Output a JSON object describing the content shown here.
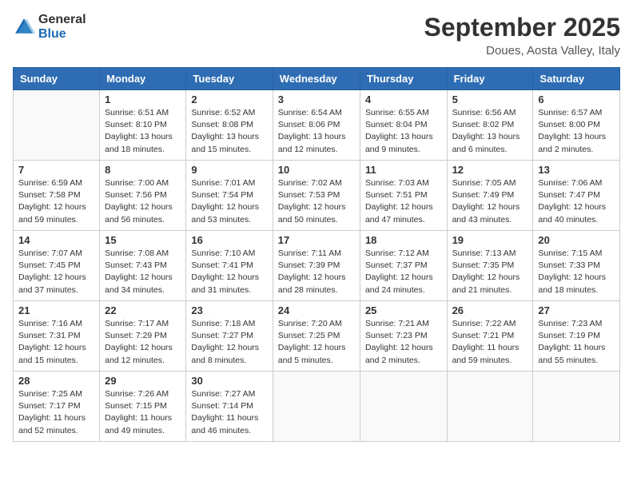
{
  "header": {
    "logo_general": "General",
    "logo_blue": "Blue",
    "month_title": "September 2025",
    "location": "Doues, Aosta Valley, Italy"
  },
  "weekdays": [
    "Sunday",
    "Monday",
    "Tuesday",
    "Wednesday",
    "Thursday",
    "Friday",
    "Saturday"
  ],
  "weeks": [
    [
      {
        "day": "",
        "info": ""
      },
      {
        "day": "1",
        "info": "Sunrise: 6:51 AM\nSunset: 8:10 PM\nDaylight: 13 hours\nand 18 minutes."
      },
      {
        "day": "2",
        "info": "Sunrise: 6:52 AM\nSunset: 8:08 PM\nDaylight: 13 hours\nand 15 minutes."
      },
      {
        "day": "3",
        "info": "Sunrise: 6:54 AM\nSunset: 8:06 PM\nDaylight: 13 hours\nand 12 minutes."
      },
      {
        "day": "4",
        "info": "Sunrise: 6:55 AM\nSunset: 8:04 PM\nDaylight: 13 hours\nand 9 minutes."
      },
      {
        "day": "5",
        "info": "Sunrise: 6:56 AM\nSunset: 8:02 PM\nDaylight: 13 hours\nand 6 minutes."
      },
      {
        "day": "6",
        "info": "Sunrise: 6:57 AM\nSunset: 8:00 PM\nDaylight: 13 hours\nand 2 minutes."
      }
    ],
    [
      {
        "day": "7",
        "info": "Sunrise: 6:59 AM\nSunset: 7:58 PM\nDaylight: 12 hours\nand 59 minutes."
      },
      {
        "day": "8",
        "info": "Sunrise: 7:00 AM\nSunset: 7:56 PM\nDaylight: 12 hours\nand 56 minutes."
      },
      {
        "day": "9",
        "info": "Sunrise: 7:01 AM\nSunset: 7:54 PM\nDaylight: 12 hours\nand 53 minutes."
      },
      {
        "day": "10",
        "info": "Sunrise: 7:02 AM\nSunset: 7:53 PM\nDaylight: 12 hours\nand 50 minutes."
      },
      {
        "day": "11",
        "info": "Sunrise: 7:03 AM\nSunset: 7:51 PM\nDaylight: 12 hours\nand 47 minutes."
      },
      {
        "day": "12",
        "info": "Sunrise: 7:05 AM\nSunset: 7:49 PM\nDaylight: 12 hours\nand 43 minutes."
      },
      {
        "day": "13",
        "info": "Sunrise: 7:06 AM\nSunset: 7:47 PM\nDaylight: 12 hours\nand 40 minutes."
      }
    ],
    [
      {
        "day": "14",
        "info": "Sunrise: 7:07 AM\nSunset: 7:45 PM\nDaylight: 12 hours\nand 37 minutes."
      },
      {
        "day": "15",
        "info": "Sunrise: 7:08 AM\nSunset: 7:43 PM\nDaylight: 12 hours\nand 34 minutes."
      },
      {
        "day": "16",
        "info": "Sunrise: 7:10 AM\nSunset: 7:41 PM\nDaylight: 12 hours\nand 31 minutes."
      },
      {
        "day": "17",
        "info": "Sunrise: 7:11 AM\nSunset: 7:39 PM\nDaylight: 12 hours\nand 28 minutes."
      },
      {
        "day": "18",
        "info": "Sunrise: 7:12 AM\nSunset: 7:37 PM\nDaylight: 12 hours\nand 24 minutes."
      },
      {
        "day": "19",
        "info": "Sunrise: 7:13 AM\nSunset: 7:35 PM\nDaylight: 12 hours\nand 21 minutes."
      },
      {
        "day": "20",
        "info": "Sunrise: 7:15 AM\nSunset: 7:33 PM\nDaylight: 12 hours\nand 18 minutes."
      }
    ],
    [
      {
        "day": "21",
        "info": "Sunrise: 7:16 AM\nSunset: 7:31 PM\nDaylight: 12 hours\nand 15 minutes."
      },
      {
        "day": "22",
        "info": "Sunrise: 7:17 AM\nSunset: 7:29 PM\nDaylight: 12 hours\nand 12 minutes."
      },
      {
        "day": "23",
        "info": "Sunrise: 7:18 AM\nSunset: 7:27 PM\nDaylight: 12 hours\nand 8 minutes."
      },
      {
        "day": "24",
        "info": "Sunrise: 7:20 AM\nSunset: 7:25 PM\nDaylight: 12 hours\nand 5 minutes."
      },
      {
        "day": "25",
        "info": "Sunrise: 7:21 AM\nSunset: 7:23 PM\nDaylight: 12 hours\nand 2 minutes."
      },
      {
        "day": "26",
        "info": "Sunrise: 7:22 AM\nSunset: 7:21 PM\nDaylight: 11 hours\nand 59 minutes."
      },
      {
        "day": "27",
        "info": "Sunrise: 7:23 AM\nSunset: 7:19 PM\nDaylight: 11 hours\nand 55 minutes."
      }
    ],
    [
      {
        "day": "28",
        "info": "Sunrise: 7:25 AM\nSunset: 7:17 PM\nDaylight: 11 hours\nand 52 minutes."
      },
      {
        "day": "29",
        "info": "Sunrise: 7:26 AM\nSunset: 7:15 PM\nDaylight: 11 hours\nand 49 minutes."
      },
      {
        "day": "30",
        "info": "Sunrise: 7:27 AM\nSunset: 7:14 PM\nDaylight: 11 hours\nand 46 minutes."
      },
      {
        "day": "",
        "info": ""
      },
      {
        "day": "",
        "info": ""
      },
      {
        "day": "",
        "info": ""
      },
      {
        "day": "",
        "info": ""
      }
    ]
  ]
}
